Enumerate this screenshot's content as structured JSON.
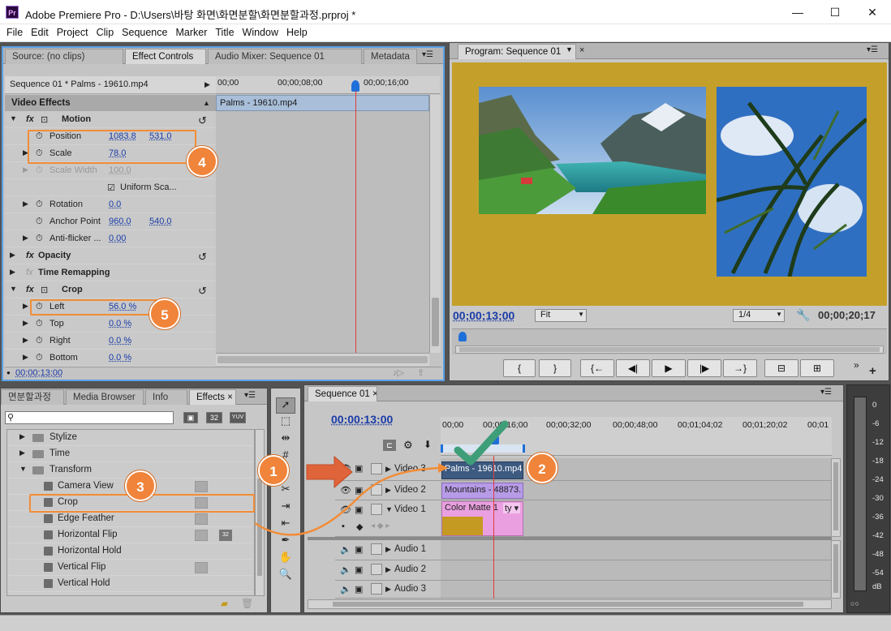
{
  "window": {
    "app_icon": "Pr",
    "title": "Adobe Premiere Pro - D:\\Users\\바탕 화면\\화면분할\\화면분할과정.prproj *",
    "minimize": "—",
    "maximize": "☐",
    "close": "✕"
  },
  "menu": [
    "File",
    "Edit",
    "Project",
    "Clip",
    "Sequence",
    "Marker",
    "Title",
    "Window",
    "Help"
  ],
  "source_panel": {
    "tabs": [
      "Source: (no clips)",
      "Effect Controls",
      "Audio Mixer: Sequence 01",
      "Metadata"
    ],
    "menu_icon": "▾☰"
  },
  "effect_controls": {
    "sequence_label": "Sequence 01 * Palms - 19610.mp4",
    "ruler": [
      "00;00",
      "00;00;08;00",
      "00;00;16;00"
    ],
    "clip_label": "Palms - 19610.mp4",
    "header": "Video Effects",
    "motion": {
      "name": "Motion",
      "position_label": "Position",
      "position_x": "1083.8",
      "position_y": "531.0",
      "scale_label": "Scale",
      "scale_value": "78.0",
      "scale_width_label": "Scale Width",
      "scale_width_value": "100.0",
      "uniform_label": "Uniform Sca...",
      "rotation_label": "Rotation",
      "rotation_value": "0.0",
      "anchor_label": "Anchor Point",
      "anchor_x": "960.0",
      "anchor_y": "540.0",
      "antiflicker_label": "Anti-flicker ...",
      "antiflicker_value": "0.00"
    },
    "opacity": "Opacity",
    "time_remap": "Time Remapping",
    "crop": {
      "name": "Crop",
      "left_label": "Left",
      "left_value": "56.0 %",
      "top_label": "Top",
      "top_value": "0.0 %",
      "right_label": "Right",
      "right_value": "0.0 %",
      "bottom_label": "Bottom",
      "bottom_value": "0.0 %"
    },
    "timecode": "00;00;13;00"
  },
  "program_monitor": {
    "tab": "Program: Sequence 01",
    "timecode": "00;00;13;00",
    "fit": "Fit",
    "resolution": "1/4",
    "duration": "00;00;20;17",
    "bg_color": "#c4a02a"
  },
  "transport": [
    "{",
    "}",
    "{←",
    "◀|",
    "▶",
    "|▶",
    "→}",
    "⊟",
    "⊞"
  ],
  "effects_panel": {
    "tabs": [
      "면분할과정",
      "Media Browser",
      "Info",
      "Effects"
    ],
    "icons": [
      "32",
      "YUV"
    ],
    "items": [
      {
        "label": "Stylize",
        "type": "folder"
      },
      {
        "label": "Time",
        "type": "folder"
      },
      {
        "label": "Transform",
        "type": "folder-open"
      },
      {
        "label": "Camera View",
        "type": "effect"
      },
      {
        "label": "Crop",
        "type": "effect"
      },
      {
        "label": "Edge Feather",
        "type": "effect"
      },
      {
        "label": "Horizontal Flip",
        "type": "effect"
      },
      {
        "label": "Horizontal Hold",
        "type": "effect"
      },
      {
        "label": "Vertical Flip",
        "type": "effect"
      },
      {
        "label": "Vertical Hold",
        "type": "effect"
      }
    ]
  },
  "timeline": {
    "tab": "Sequence 01",
    "timecode": "00:00:13:00",
    "ruler": [
      "00;00",
      "00;00;16;00",
      "00;00;32;00",
      "00;00;48;00",
      "00;01;04;02",
      "00;01;20;02",
      "00;01"
    ],
    "tracks": [
      {
        "name": "Video 3",
        "clip": "Palms - 19610.mp4"
      },
      {
        "name": "Video 2",
        "clip": "Mountains - 48873."
      },
      {
        "name": "Video 1",
        "clip": "Color Matte 1",
        "fx": "ty"
      },
      {
        "name": "Audio 1"
      },
      {
        "name": "Audio 2"
      },
      {
        "name": "Audio 3"
      }
    ]
  },
  "audio_meter": {
    "labels": [
      "0",
      "-6",
      "-12",
      "-18",
      "-24",
      "-30",
      "-36",
      "-42",
      "-48",
      "-54",
      "dB"
    ]
  },
  "annotations": [
    "1",
    "2",
    "3",
    "4",
    "5"
  ]
}
